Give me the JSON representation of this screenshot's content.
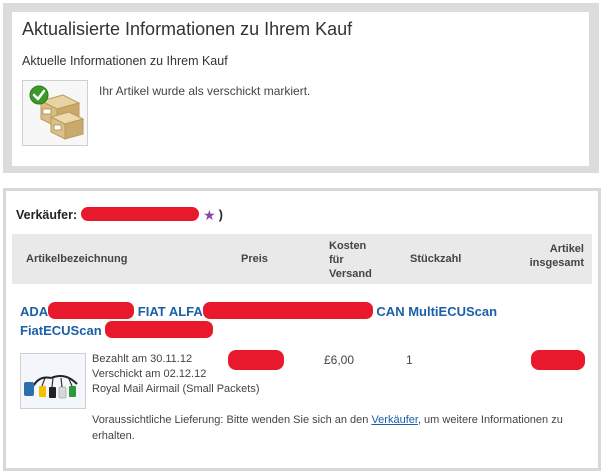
{
  "header": {
    "title": "Aktualisierte Informationen zu Ihrem Kauf",
    "subtitle": "Aktuelle Informationen zu Ihrem Kauf",
    "notice": "Ihr Artikel wurde als verschickt markiert."
  },
  "order": {
    "seller_label": "Verkäufer:",
    "seller_close": ")",
    "columns": {
      "name": "Artikelbezeichnung",
      "price": "Preis",
      "ship_line1": "Kosten",
      "ship_line2": "für",
      "ship_line3": "Versand",
      "qty": "Stückzahl",
      "total_line1": "Artikel",
      "total_line2": "insgesamt"
    },
    "item": {
      "title_part1": "ADA",
      "title_part2": "FIAT ALFA",
      "title_part3": "CAN MultiECUScan",
      "title_part4": "FiatECUScan",
      "paid": "Bezahlt am 30.11.12",
      "shipped": "Verschickt am 02.12.12",
      "shipping_method": "Royal Mail Airmail (Small Packets)",
      "shipping_cost": "£6,00",
      "quantity": "1"
    },
    "delivery": {
      "prefix": "Voraussichtliche Lieferung: Bitte wenden Sie sich an den ",
      "link": "Verkäufer",
      "suffix": ", um weitere Informationen zu erhalten."
    }
  },
  "colors": {
    "link": "#1a5fa8",
    "redaction": "#e8192c",
    "check": "#3c9a2a"
  }
}
